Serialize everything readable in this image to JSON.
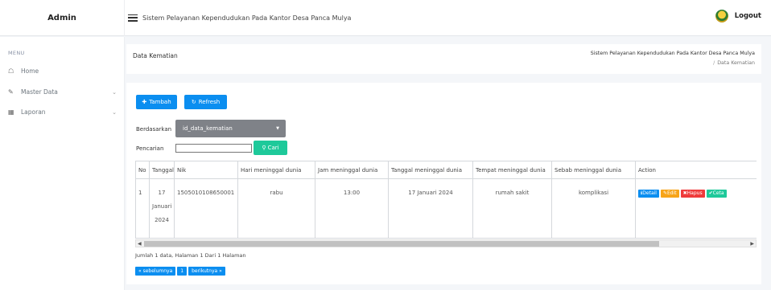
{
  "header": {
    "brand": "Admin",
    "system_title": "Sistem Pelayanan Kependudukan Pada Kantor Desa Panca Mulya",
    "logout_label": "Logout"
  },
  "sidebar": {
    "menu_label": "MENU",
    "items": [
      {
        "label": "Home",
        "icon": "home-icon"
      },
      {
        "label": "Master Data",
        "icon": "edit-icon"
      },
      {
        "label": "Laporan",
        "icon": "calendar-icon"
      }
    ]
  },
  "page": {
    "title": "Data Kematian",
    "breadcrumb_top": "Sistem Pelayanan Kependudukan Pada Kantor Desa Panca Mulya",
    "breadcrumb_current": "Data Kematian"
  },
  "toolbar": {
    "add_label": "Tambah",
    "refresh_label": "Refresh"
  },
  "filter": {
    "based_on_label": "Berdasarkan",
    "based_on_value": "id_data_kematian",
    "search_label": "Pencarian",
    "search_value": "",
    "search_button": "Cari"
  },
  "table": {
    "columns": [
      "No",
      "Tanggal",
      "Nik",
      "Hari meninggal dunia",
      "Jam meninggal dunia",
      "Tanggal meninggal dunia",
      "Tempat meninggal dunia",
      "Sebab meninggal dunia",
      "Action"
    ],
    "rows": [
      {
        "no": "1",
        "tanggal": "17 Januari 2024",
        "nik": "1505010108650001",
        "hari": "rabu",
        "jam": "13:00",
        "tanggal_meninggal": "17 Januari 2024",
        "tempat": "rumah sakit",
        "sebab": "komplikasi"
      }
    ],
    "actions": {
      "detail": "Detail",
      "edit": "Edit",
      "hapus": "Hapus",
      "cetak": "Ceta"
    }
  },
  "summary": "Jumlah 1 data, Halaman 1 Dari 1 Halaman",
  "pagination": {
    "prev": "« sebelumnya",
    "current": "1",
    "next": "berikutnya »"
  },
  "colors": {
    "primary": "#0b8ef0",
    "success": "#1ec99a",
    "warning": "#f7a418",
    "danger": "#ef3b3b"
  }
}
